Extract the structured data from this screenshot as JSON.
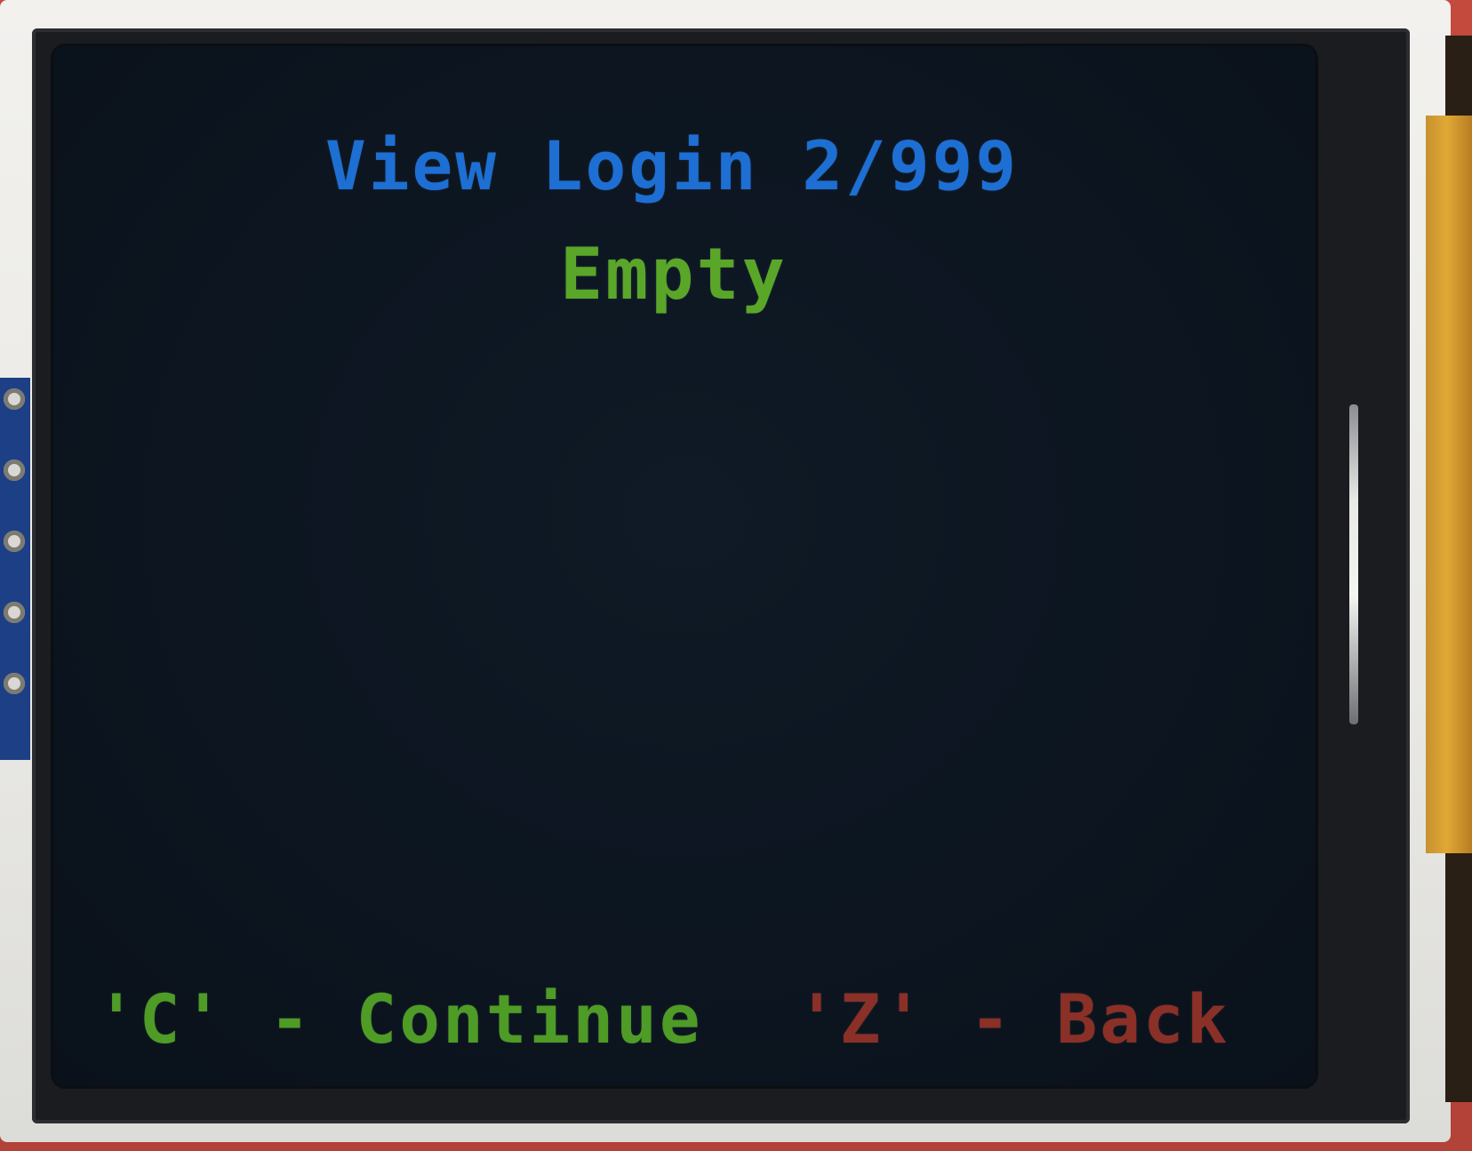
{
  "screen": {
    "title": "View Login 2/999",
    "status": "Empty"
  },
  "controls": {
    "continue_hint": "'C' - Continue",
    "back_hint": "'Z' - Back"
  },
  "colors": {
    "title": "#1d6fd4",
    "status": "#5aa629",
    "continue": "#4e9b26",
    "back": "#8b3027",
    "lcd_background": "#0c1520",
    "pcb": "#1c3f86",
    "flex_cable": "#e0a935"
  }
}
